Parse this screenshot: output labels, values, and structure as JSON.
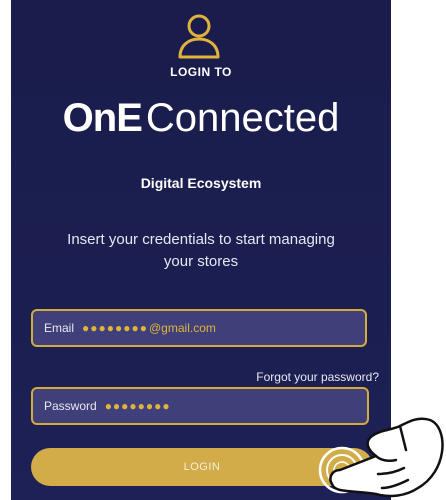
{
  "header": {
    "icon": "user-icon",
    "login_to": "LOGIN TO"
  },
  "brand": {
    "part1": "OnE",
    "part2": "Connected"
  },
  "subtitle": "Digital Ecosystem",
  "instructions": "Insert your credentials to start managing your stores",
  "email_field": {
    "label": "Email",
    "masked_value": "●●●●●●●●",
    "domain": "@gmail.com"
  },
  "forgot_password": "Forgot your password?",
  "password_field": {
    "label": "Password",
    "masked_value": "●●●●●●●●"
  },
  "login_button": {
    "label": "LOGIN"
  },
  "colors": {
    "background": "#1b1e50",
    "accent": "#d4aa3c",
    "field_fill": "#3f3f7a",
    "button": "#d2ac48"
  },
  "overlay_icon": "pointing-hand-icon"
}
